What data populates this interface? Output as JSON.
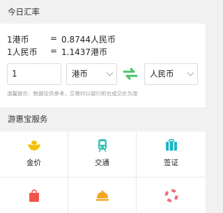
{
  "rates": {
    "title": "今日汇率",
    "row1": {
      "lhs": "1港币",
      "eq": "=",
      "rhs": "0.8744人民币"
    },
    "row2": {
      "lhs": "1人民币",
      "eq": "=",
      "rhs": "1.1437港币"
    },
    "amount_value": "1",
    "from_currency": "港币",
    "to_currency": "人民币",
    "tip": "温馨提示：数据仅供参考，交易时以银行柜台成交价为准"
  },
  "services": {
    "title": "游惠宝服务",
    "items": [
      {
        "label": "金价",
        "icon": "gold-ingot-icon",
        "color": "#f2c200"
      },
      {
        "label": "交通",
        "icon": "train-icon",
        "color": "#35c2b0"
      },
      {
        "label": "签证",
        "icon": "suitcase-icon",
        "color": "#1fb5c5"
      },
      {
        "label": "",
        "icon": "shopping-bag-icon",
        "color": "#f0554a"
      },
      {
        "label": "",
        "icon": "food-dish-icon",
        "color": "#f5a623"
      },
      {
        "label": "",
        "icon": "lifebuoy-icon",
        "color": "#f06b7a"
      }
    ]
  },
  "colors": {
    "swap_icon": "#4cc26d",
    "tip_text": "#9a9a9a"
  }
}
